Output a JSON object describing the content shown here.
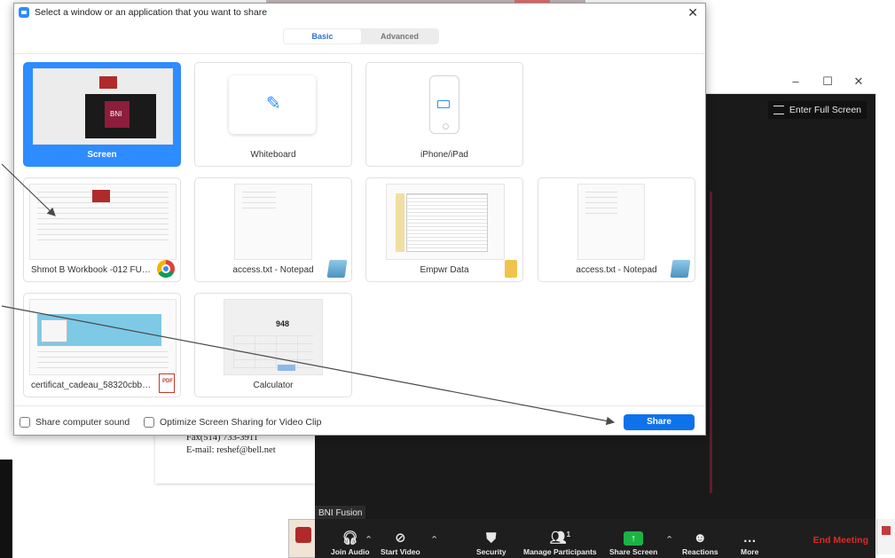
{
  "dialog": {
    "title": "Select a window or an application that you want to share",
    "close_glyph": "✕",
    "tabs": [
      {
        "label": "Basic",
        "active": true
      },
      {
        "label": "Advanced",
        "active": false
      }
    ],
    "tiles": [
      {
        "label": "Screen",
        "selected": true
      },
      {
        "label": "Whiteboard"
      },
      {
        "label": "iPhone/iPad"
      },
      {
        "label": "Shmot B Workbook -012 FULL VE...",
        "badge": "chrome-icon"
      },
      {
        "label": "access.txt - Notepad",
        "badge": "notepad-icon"
      },
      {
        "label": "Empwr Data",
        "badge": "folder-icon"
      },
      {
        "label": "access.txt - Notepad",
        "badge": "notepad-icon"
      },
      {
        "label": "certificat_cadeau_58320cbb70a10...",
        "badge": "pdf-icon"
      },
      {
        "label": "Calculator",
        "preview_number": "948"
      }
    ],
    "footer": {
      "share_sound": "Share computer sound",
      "optimize_video": "Optimize Screen Sharing for Video Clip",
      "share_button": "Share"
    },
    "pdf_badge_text": "PDF",
    "screen_preview_text": "BNI"
  },
  "meeting": {
    "window_controls": [
      "–",
      "☐",
      "✕"
    ],
    "enter_full_screen": "Enter Full Screen",
    "participant_name": "BNI Fusion",
    "participant_count": "1",
    "toolbar": {
      "join_audio": "Join Audio",
      "start_video": "Start Video",
      "security": "Security",
      "manage_participants": "Manage Participants",
      "share_screen": "Share Screen",
      "reactions": "Reactions",
      "more": "More",
      "end_meeting": "End Meeting"
    }
  },
  "background_doc": {
    "fax": "Fax(514) 733-3911",
    "email": "E-mail: reshef@bell.net"
  },
  "colors": {
    "accent": "#2d8cff",
    "share_button": "#0e72ed",
    "end_meeting": "#e02828",
    "share_screen_green": "#1bb346"
  }
}
